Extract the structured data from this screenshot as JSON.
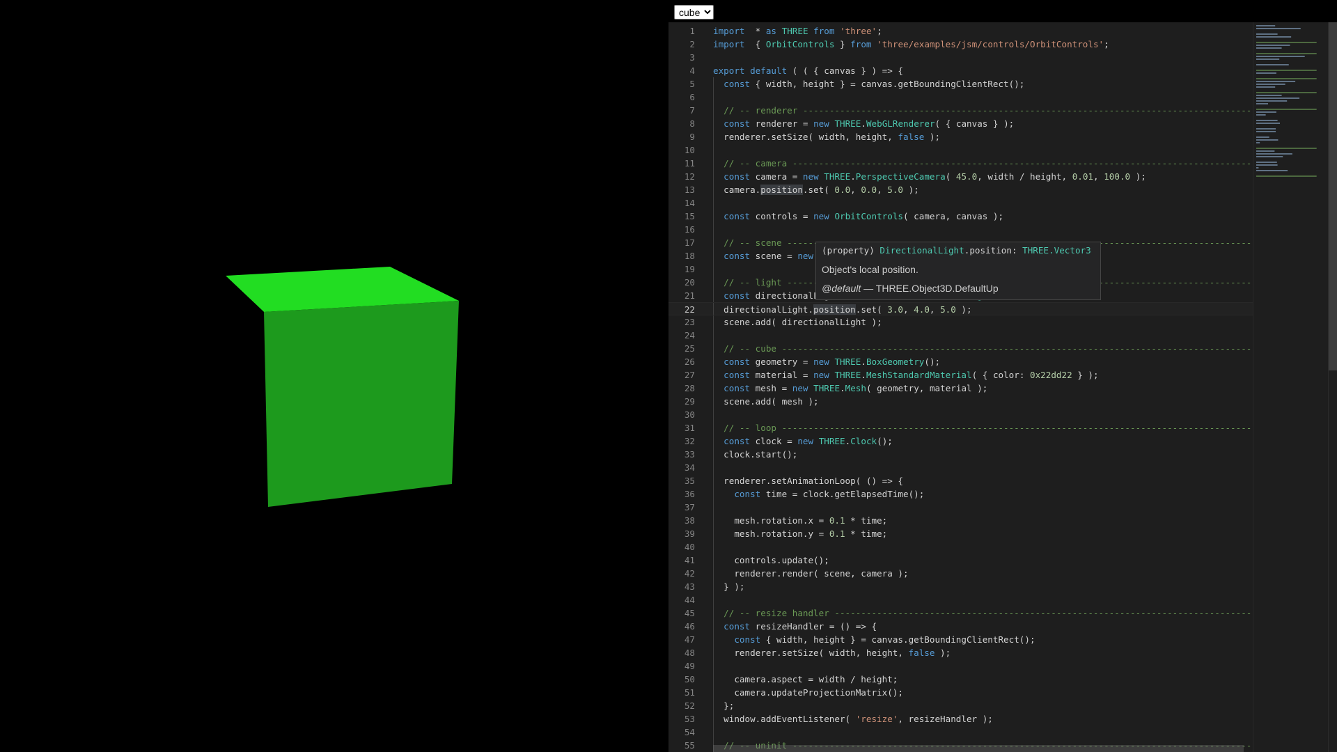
{
  "sample_select": {
    "value": "cube",
    "options": [
      "cube"
    ]
  },
  "scene": {
    "cube_color": "#22dd22"
  },
  "editor": {
    "current_line": 22,
    "lines": [
      [
        [
          "kw",
          "import"
        ],
        [
          "",
          "  * "
        ],
        [
          "kw",
          "as"
        ],
        [
          "",
          " "
        ],
        [
          "type",
          "THREE"
        ],
        [
          "",
          " "
        ],
        [
          "kw",
          "from"
        ],
        [
          "",
          " "
        ],
        [
          "str",
          "'three'"
        ],
        [
          "",
          ";"
        ]
      ],
      [
        [
          "kw",
          "import"
        ],
        [
          "",
          "  { "
        ],
        [
          "type",
          "OrbitControls"
        ],
        [
          "",
          " } "
        ],
        [
          "kw",
          "from"
        ],
        [
          "",
          " "
        ],
        [
          "str",
          "'three/examples/jsm/controls/OrbitControls'"
        ],
        [
          "",
          ";"
        ]
      ],
      [],
      [
        [
          "kw",
          "export"
        ],
        [
          "",
          " "
        ],
        [
          "kw",
          "default"
        ],
        [
          "",
          " ( ( { canvas } ) => {"
        ]
      ],
      [
        [
          "",
          "  "
        ],
        [
          "kw",
          "const"
        ],
        [
          "",
          " { width, height } = canvas.getBoundingClientRect();"
        ]
      ],
      [],
      [
        [
          "",
          "  "
        ],
        [
          "com",
          "// -- renderer -------------------------------------------------------------------------------------"
        ]
      ],
      [
        [
          "",
          "  "
        ],
        [
          "kw",
          "const"
        ],
        [
          "",
          " renderer = "
        ],
        [
          "kw",
          "new"
        ],
        [
          "",
          " "
        ],
        [
          "type",
          "THREE"
        ],
        [
          "",
          "."
        ],
        [
          "type",
          "WebGLRenderer"
        ],
        [
          "",
          "( { canvas } );"
        ]
      ],
      [
        [
          "",
          "  renderer.setSize( width, height, "
        ],
        [
          "kw",
          "false"
        ],
        [
          "",
          " );"
        ]
      ],
      [],
      [
        [
          "",
          "  "
        ],
        [
          "com",
          "// -- camera ---------------------------------------------------------------------------------------"
        ]
      ],
      [
        [
          "",
          "  "
        ],
        [
          "kw",
          "const"
        ],
        [
          "",
          " camera = "
        ],
        [
          "kw",
          "new"
        ],
        [
          "",
          " "
        ],
        [
          "type",
          "THREE"
        ],
        [
          "",
          "."
        ],
        [
          "type",
          "PerspectiveCamera"
        ],
        [
          "",
          "( "
        ],
        [
          "num",
          "45.0"
        ],
        [
          "",
          ", width / height, "
        ],
        [
          "num",
          "0.01"
        ],
        [
          "",
          ", "
        ],
        [
          "num",
          "100.0"
        ],
        [
          "",
          " );"
        ]
      ],
      [
        [
          "",
          "  camera."
        ],
        [
          "hl",
          "position"
        ],
        [
          "",
          ".set( "
        ],
        [
          "num",
          "0.0"
        ],
        [
          "",
          ", "
        ],
        [
          "num",
          "0.0"
        ],
        [
          "",
          ", "
        ],
        [
          "num",
          "5.0"
        ],
        [
          "",
          " );"
        ]
      ],
      [],
      [
        [
          "",
          "  "
        ],
        [
          "kw",
          "const"
        ],
        [
          "",
          " controls = "
        ],
        [
          "kw",
          "new"
        ],
        [
          "",
          " "
        ],
        [
          "type",
          "OrbitControls"
        ],
        [
          "",
          "( camera, canvas );"
        ]
      ],
      [],
      [
        [
          "",
          "  "
        ],
        [
          "com",
          "// -- scene ----------------------------------------------------------------------------------------"
        ]
      ],
      [
        [
          "",
          "  "
        ],
        [
          "kw",
          "const"
        ],
        [
          "",
          " scene = "
        ],
        [
          "kw",
          "new"
        ],
        [
          "",
          " "
        ],
        [
          "type",
          "THREE"
        ],
        [
          "",
          "."
        ],
        [
          "type",
          "Scene"
        ],
        [
          "",
          "();"
        ]
      ],
      [],
      [
        [
          "",
          "  "
        ],
        [
          "com",
          "// -- light ----------------------------------------------------------------------------------------"
        ]
      ],
      [
        [
          "",
          "  "
        ],
        [
          "kw",
          "const"
        ],
        [
          "",
          " directionalLight = "
        ],
        [
          "kw",
          "new"
        ],
        [
          "",
          " "
        ],
        [
          "type",
          "THREE"
        ],
        [
          "",
          "."
        ],
        [
          "type",
          "DirectionalLight"
        ],
        [
          "",
          "( "
        ],
        [
          "num",
          "0xffffff"
        ],
        [
          "",
          " );"
        ]
      ],
      [
        [
          "",
          "  directionalLight."
        ],
        [
          "hl",
          "position"
        ],
        [
          "",
          ".set( "
        ],
        [
          "num",
          "3.0"
        ],
        [
          "",
          ", "
        ],
        [
          "num",
          "4.0"
        ],
        [
          "",
          ", "
        ],
        [
          "num",
          "5.0"
        ],
        [
          "",
          " );"
        ]
      ],
      [
        [
          "",
          "  scene.add( directionalLight );"
        ]
      ],
      [],
      [
        [
          "",
          "  "
        ],
        [
          "com",
          "// -- cube -----------------------------------------------------------------------------------------"
        ]
      ],
      [
        [
          "",
          "  "
        ],
        [
          "kw",
          "const"
        ],
        [
          "",
          " geometry = "
        ],
        [
          "kw",
          "new"
        ],
        [
          "",
          " "
        ],
        [
          "type",
          "THREE"
        ],
        [
          "",
          "."
        ],
        [
          "type",
          "BoxGeometry"
        ],
        [
          "",
          "();"
        ]
      ],
      [
        [
          "",
          "  "
        ],
        [
          "kw",
          "const"
        ],
        [
          "",
          " material = "
        ],
        [
          "kw",
          "new"
        ],
        [
          "",
          " "
        ],
        [
          "type",
          "THREE"
        ],
        [
          "",
          "."
        ],
        [
          "type",
          "MeshStandardMaterial"
        ],
        [
          "",
          "( { color: "
        ],
        [
          "num",
          "0x22dd22"
        ],
        [
          "",
          " } );"
        ]
      ],
      [
        [
          "",
          "  "
        ],
        [
          "kw",
          "const"
        ],
        [
          "",
          " mesh = "
        ],
        [
          "kw",
          "new"
        ],
        [
          "",
          " "
        ],
        [
          "type",
          "THREE"
        ],
        [
          "",
          "."
        ],
        [
          "type",
          "Mesh"
        ],
        [
          "",
          "( geometry, material );"
        ]
      ],
      [
        [
          "",
          "  scene.add( mesh );"
        ]
      ],
      [],
      [
        [
          "",
          "  "
        ],
        [
          "com",
          "// -- loop -----------------------------------------------------------------------------------------"
        ]
      ],
      [
        [
          "",
          "  "
        ],
        [
          "kw",
          "const"
        ],
        [
          "",
          " clock = "
        ],
        [
          "kw",
          "new"
        ],
        [
          "",
          " "
        ],
        [
          "type",
          "THREE"
        ],
        [
          "",
          "."
        ],
        [
          "type",
          "Clock"
        ],
        [
          "",
          "();"
        ]
      ],
      [
        [
          "",
          "  clock.start();"
        ]
      ],
      [],
      [
        [
          "",
          "  renderer.setAnimationLoop( () => {"
        ]
      ],
      [
        [
          "",
          "    "
        ],
        [
          "kw",
          "const"
        ],
        [
          "",
          " time = clock.getElapsedTime();"
        ]
      ],
      [],
      [
        [
          "",
          "    mesh.rotation.x = "
        ],
        [
          "num",
          "0.1"
        ],
        [
          "",
          " * time;"
        ]
      ],
      [
        [
          "",
          "    mesh.rotation.y = "
        ],
        [
          "num",
          "0.1"
        ],
        [
          "",
          " * time;"
        ]
      ],
      [],
      [
        [
          "",
          "    controls.update();"
        ]
      ],
      [
        [
          "",
          "    renderer.render( scene, camera );"
        ]
      ],
      [
        [
          "",
          "  } );"
        ]
      ],
      [],
      [
        [
          "",
          "  "
        ],
        [
          "com",
          "// -- resize handler -------------------------------------------------------------------------------"
        ]
      ],
      [
        [
          "",
          "  "
        ],
        [
          "kw",
          "const"
        ],
        [
          "",
          " resizeHandler = () => {"
        ]
      ],
      [
        [
          "",
          "    "
        ],
        [
          "kw",
          "const"
        ],
        [
          "",
          " { width, height } = canvas.getBoundingClientRect();"
        ]
      ],
      [
        [
          "",
          "    renderer.setSize( width, height, "
        ],
        [
          "kw",
          "false"
        ],
        [
          "",
          " );"
        ]
      ],
      [],
      [
        [
          "",
          "    camera.aspect = width / height;"
        ]
      ],
      [
        [
          "",
          "    camera.updateProjectionMatrix();"
        ]
      ],
      [
        [
          "",
          "  };"
        ]
      ],
      [
        [
          "",
          "  window.addEventListener( "
        ],
        [
          "str",
          "'resize'"
        ],
        [
          "",
          ", resizeHandler );"
        ]
      ],
      [],
      [
        [
          "",
          "  "
        ],
        [
          "com",
          "// -- uninit ---------------------------------------------------------------------------------------"
        ]
      ]
    ]
  },
  "tooltip": {
    "prefix": "(property) ",
    "class_name": "DirectionalLight",
    "member": ".position: ",
    "type_name": "THREE.Vector3",
    "description": "Object's local position.",
    "tag_name": "@default",
    "tag_text": " — THREE.Object3D.DefaultUp"
  }
}
